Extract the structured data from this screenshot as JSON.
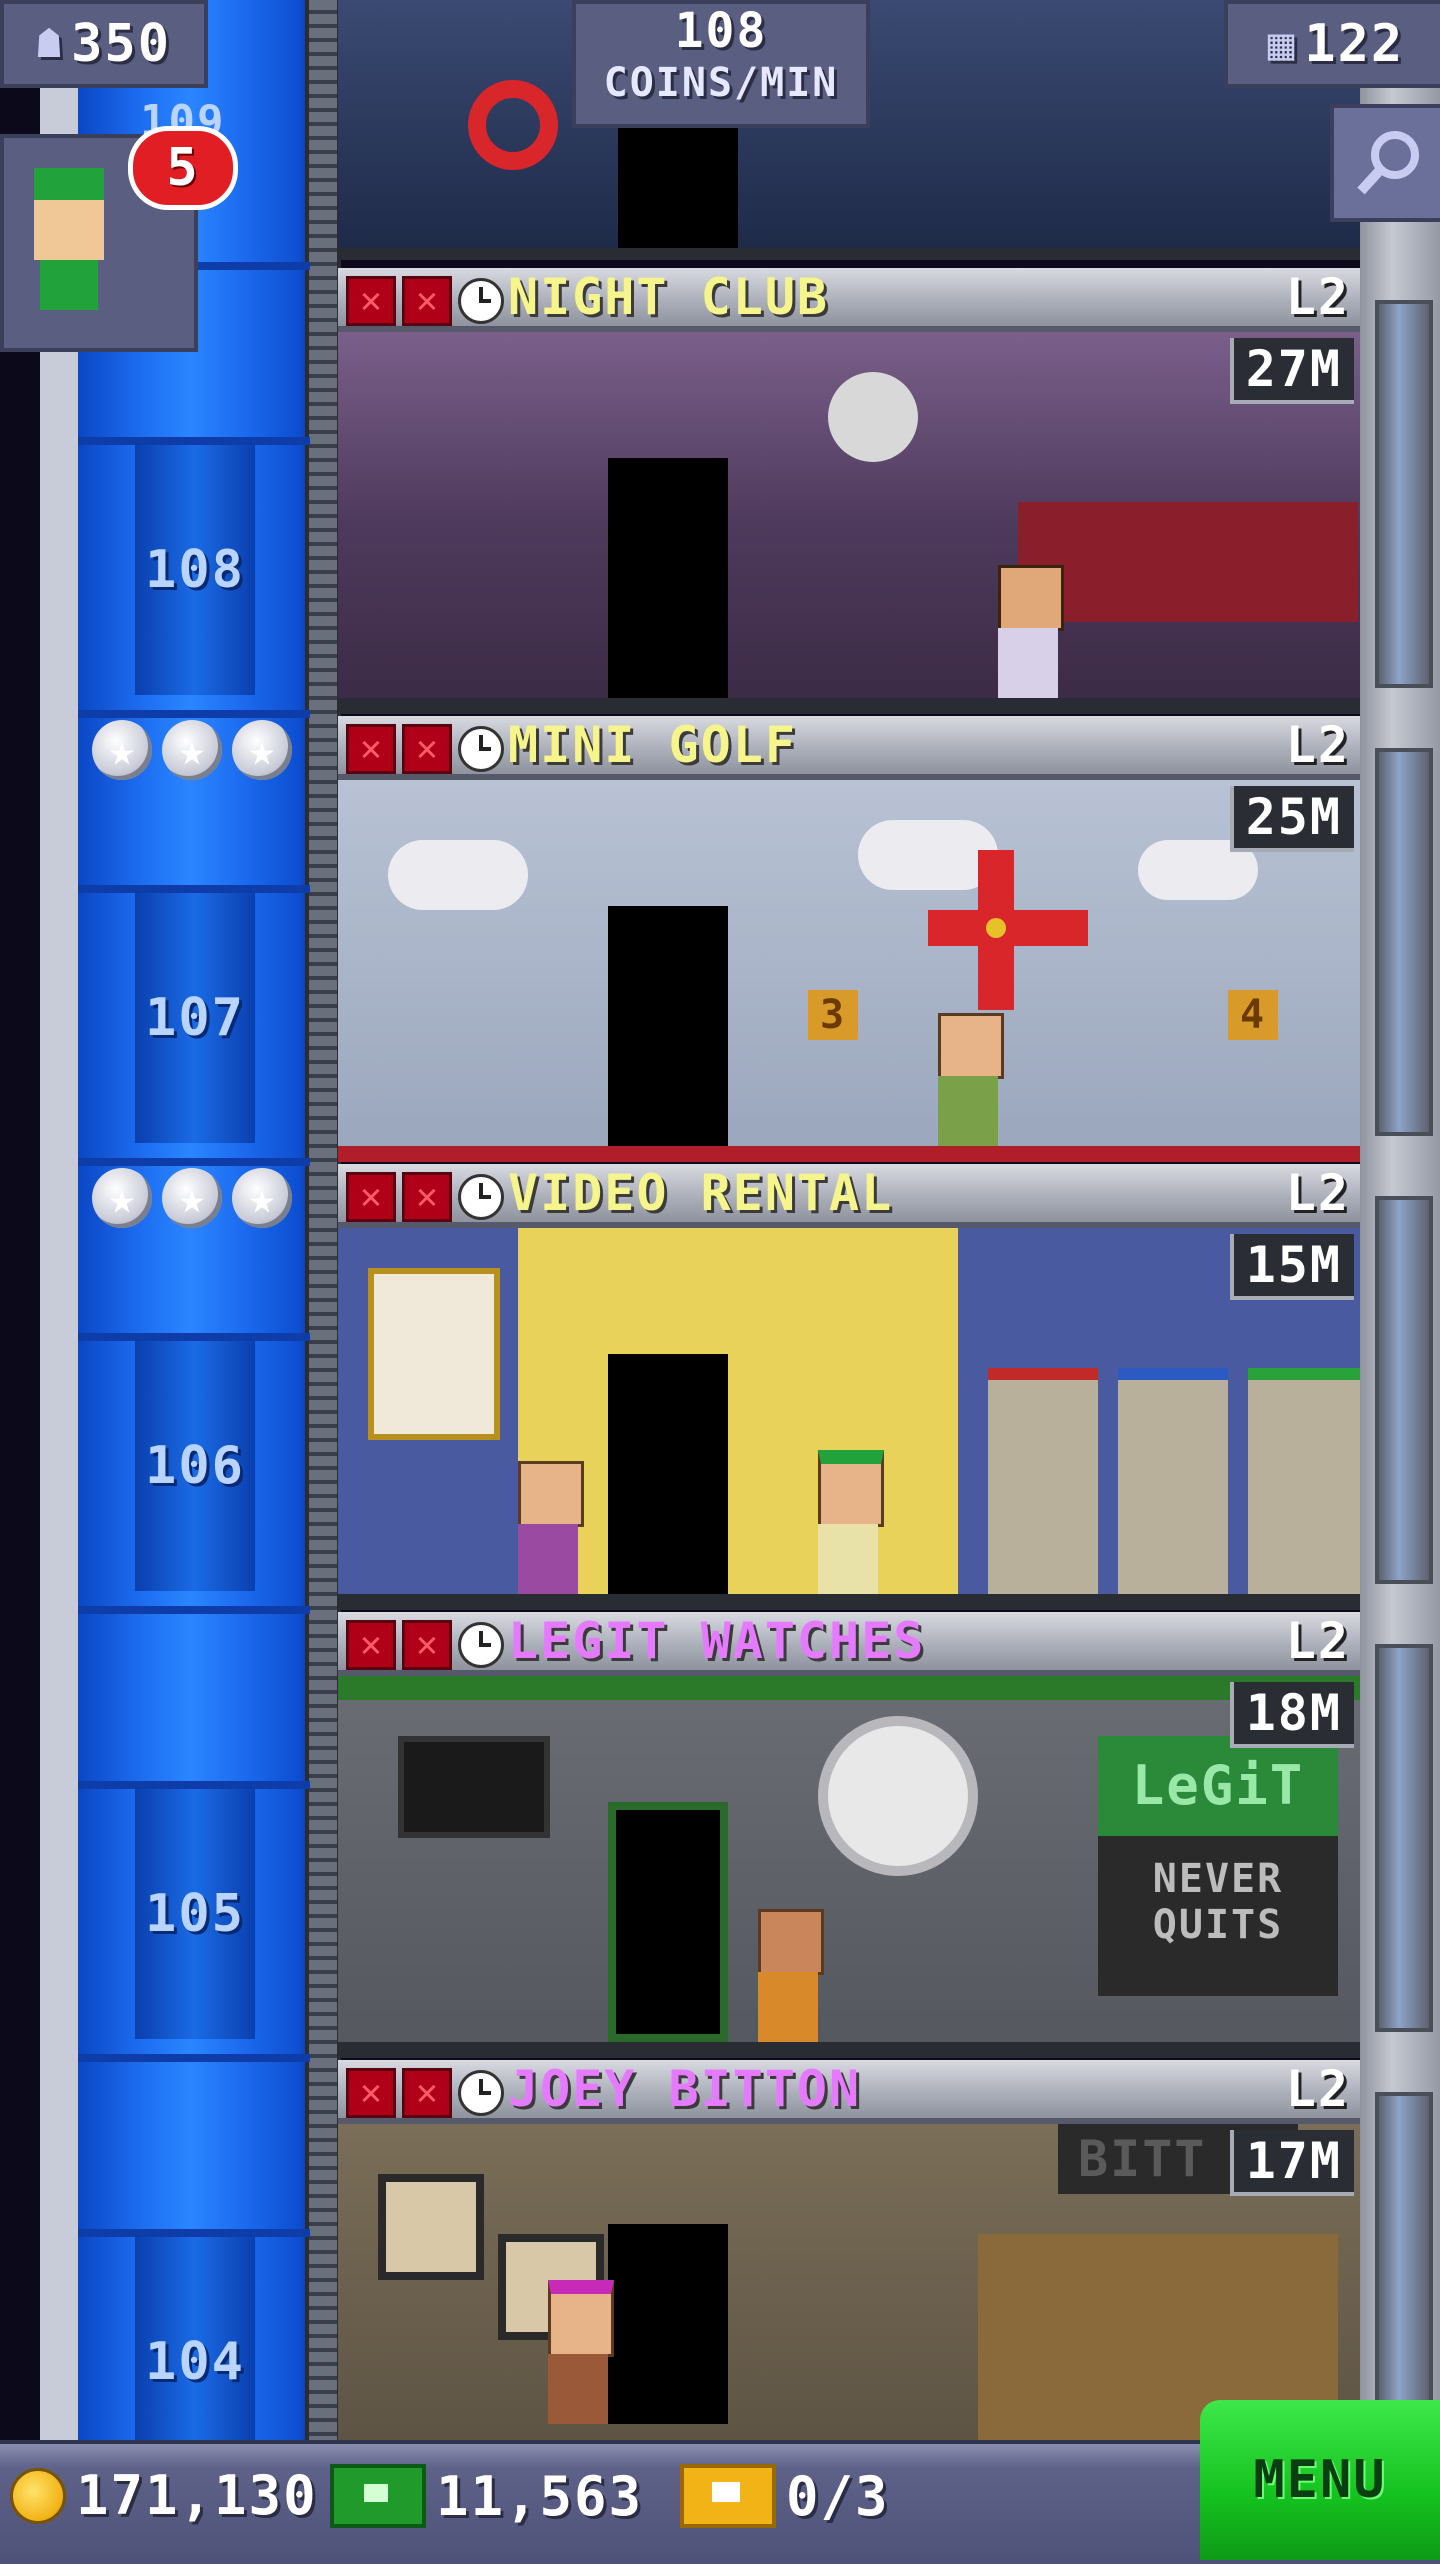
{
  "hud": {
    "population": "350",
    "coins_per_min_value": "108",
    "coins_per_min_label": "COINS/MIN",
    "floor_count": "122",
    "elevator_top_floor": "109"
  },
  "bitizen_notification_count": "5",
  "floors": [
    {
      "number": "108",
      "name": "NIGHT CLUB",
      "level": "L2",
      "cost": "27M",
      "name_color": "#f5f58c",
      "stars": 0
    },
    {
      "number": "107",
      "name": "MINI GOLF",
      "level": "L2",
      "cost": "25M",
      "name_color": "#f5f58c",
      "stars": 3
    },
    {
      "number": "106",
      "name": "VIDEO RENTAL",
      "level": "L2",
      "cost": "15M",
      "name_color": "#f5f58c",
      "stars": 3
    },
    {
      "number": "105",
      "name": "LEGIT WATCHES",
      "level": "L2",
      "cost": "18M",
      "name_color": "#e67aff",
      "stars": 0
    },
    {
      "number": "104",
      "name": "JOEY BITTON",
      "level": "L2",
      "cost": "17M",
      "name_color": "#e67aff",
      "stars": 0
    }
  ],
  "scenery_text": {
    "golf_hole_3": "3",
    "golf_hole_4": "4",
    "legit_sign": "LeGiT",
    "legit_slogan_1": "NEVER",
    "legit_slogan_2": "QUITS",
    "bitton_sign": "BITT"
  },
  "bottom_bar": {
    "coins": "171,130",
    "bux": "11,563",
    "tickets": "0/3",
    "menu_label": "MENU"
  },
  "colors": {
    "shaft_blue": "#1d6cf0",
    "menu_green": "#14c21f",
    "badge_red": "#e01e24",
    "commercial_name": "#f5f58c",
    "retail_name": "#e67aff"
  }
}
